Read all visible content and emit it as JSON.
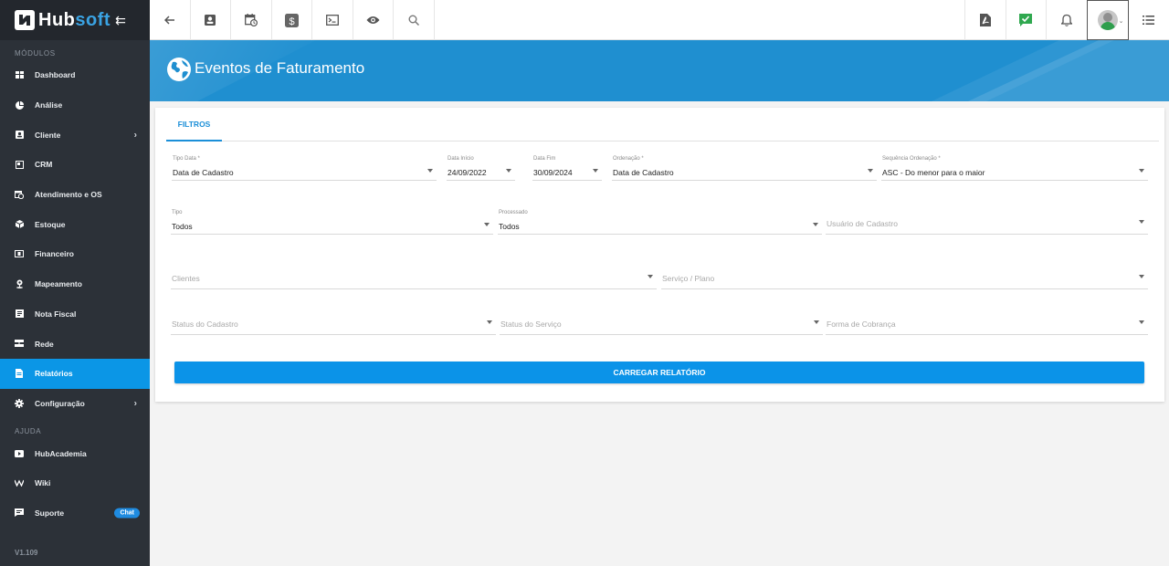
{
  "brand": {
    "name_main": "Hub",
    "name_accent": "soft",
    "collapse_glyph": "⇇"
  },
  "sidebar": {
    "modules_title": "MÓDULOS",
    "items": [
      {
        "label": "Dashboard",
        "icon": "dashboard-icon"
      },
      {
        "label": "Análise",
        "icon": "chart-icon"
      },
      {
        "label": "Cliente",
        "icon": "contact-card-icon",
        "chevron": "›"
      },
      {
        "label": "CRM",
        "icon": "crm-icon"
      },
      {
        "label": "Atendimento e OS",
        "icon": "calendar-clock-icon"
      },
      {
        "label": "Estoque",
        "icon": "box-icon"
      },
      {
        "label": "Financeiro",
        "icon": "money-icon"
      },
      {
        "label": "Mapeamento",
        "icon": "map-pin-icon"
      },
      {
        "label": "Nota Fiscal",
        "icon": "invoice-icon"
      },
      {
        "label": "Rede",
        "icon": "network-icon"
      },
      {
        "label": "Relatórios",
        "icon": "report-icon",
        "active": true
      },
      {
        "label": "Configuração",
        "icon": "gear-icon",
        "chevron": "›"
      }
    ],
    "help_title": "AJUDA",
    "help_items": [
      {
        "label": "HubAcademia",
        "icon": "video-icon"
      },
      {
        "label": "Wiki",
        "icon": "wiki-icon"
      },
      {
        "label": "Suporte",
        "icon": "chat-icon",
        "badge": "Chat"
      }
    ],
    "version": "V1.109"
  },
  "topbar": {
    "left_icons": [
      "back-arrow-icon",
      "contact-card-icon",
      "calendar-clock-icon",
      "dollar-icon",
      "terminal-icon",
      "eye-icon",
      "search-icon"
    ],
    "right_icons": [
      "pdf-icon",
      "check-message-icon",
      "bell-icon",
      "avatar",
      "list-icon"
    ],
    "accent": "#0b96e6"
  },
  "page": {
    "title": "Eventos de Faturamento"
  },
  "tabs": {
    "filters": "FILTROS"
  },
  "filters": {
    "tipo_data": {
      "label": "Tipo Data *",
      "value": "Data de Cadastro"
    },
    "data_inicio": {
      "label": "Data Início",
      "value": "24/09/2022"
    },
    "data_fim": {
      "label": "Data Fim",
      "value": "30/09/2024"
    },
    "ordenacao": {
      "label": "Ordenação *",
      "value": "Data de Cadastro"
    },
    "sequencia": {
      "label": "Sequência Ordenação *",
      "value": "ASC - Do menor para o maior"
    },
    "tipo": {
      "label": "Tipo",
      "value": "Todos"
    },
    "processado": {
      "label": "Processado",
      "value": "Todos"
    },
    "usuario_cadastro": {
      "placeholder": "Usuário de Cadastro"
    },
    "clientes": {
      "placeholder": "Clientes"
    },
    "servico_plano": {
      "placeholder": "Serviço / Plano"
    },
    "status_cadastro": {
      "placeholder": "Status do Cadastro"
    },
    "status_servico": {
      "placeholder": "Status do Serviço"
    },
    "forma_cobranca": {
      "placeholder": "Forma de Cobrança"
    }
  },
  "actions": {
    "load_report": "CARREGAR RELATÓRIO"
  }
}
